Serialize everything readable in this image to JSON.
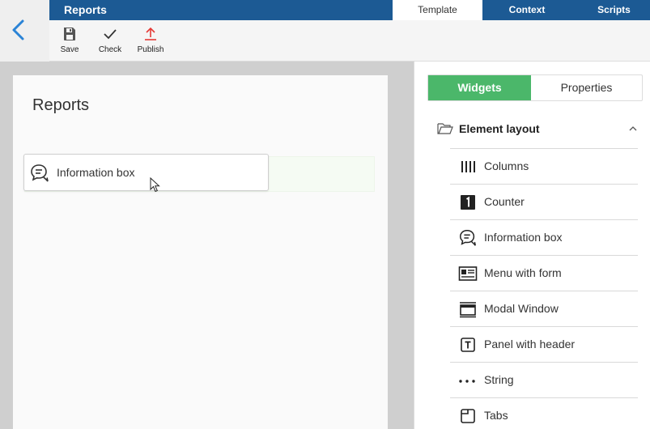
{
  "header": {
    "title": "Reports",
    "tabs": [
      {
        "label": "Template"
      },
      {
        "label": "Context"
      },
      {
        "label": "Scripts"
      }
    ]
  },
  "toolbar": {
    "save_label": "Save",
    "check_label": "Check",
    "publish_label": "Publish"
  },
  "canvas": {
    "page_title": "Reports",
    "dragged_widget": "Information box"
  },
  "sidebar": {
    "tab_widgets": "Widgets",
    "tab_properties": "Properties",
    "group_label": "Element layout",
    "items": [
      {
        "label": "Columns",
        "icon": "columns-icon"
      },
      {
        "label": "Counter",
        "icon": "counter-icon"
      },
      {
        "label": "Information box",
        "icon": "chat-bubbles-icon"
      },
      {
        "label": "Menu with form",
        "icon": "menu-form-icon"
      },
      {
        "label": "Modal Window",
        "icon": "modal-window-icon"
      },
      {
        "label": "Panel with header",
        "icon": "panel-header-icon"
      },
      {
        "label": "String",
        "icon": "dots-icon"
      },
      {
        "label": "Tabs",
        "icon": "tabs-icon"
      }
    ]
  },
  "colors": {
    "topbar": "#1c5a94",
    "accent_green": "#4bb76a",
    "publish_red": "#e53935",
    "back_blue": "#2a83d6"
  }
}
